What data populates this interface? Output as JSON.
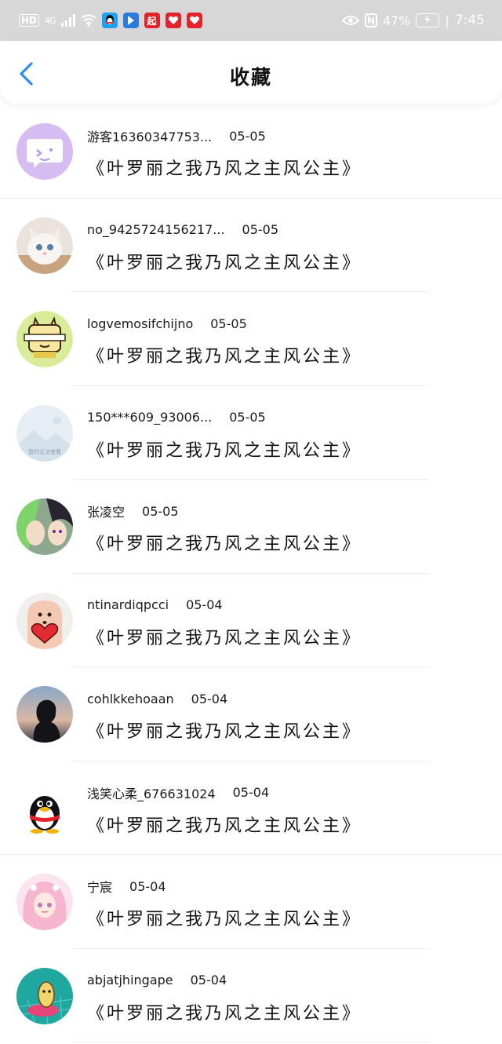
{
  "status_bar": {
    "hd": "HD",
    "signal": "4G",
    "app_qi": "起",
    "battery": "47%",
    "time": "7:45"
  },
  "header": {
    "title": "收藏",
    "back_icon": "chevron-left-icon",
    "accent": "#2f8cf0"
  },
  "items": [
    {
      "user": "游客16360347753...",
      "date": "05-05",
      "title": "《叶罗丽之我乃风之主风公主》"
    },
    {
      "user": "no_9425724156217...",
      "date": "05-05",
      "title": "《叶罗丽之我乃风之主风公主》"
    },
    {
      "user": "logvemosifchijno",
      "date": "05-05",
      "title": "《叶罗丽之我乃风之主风公主》"
    },
    {
      "user": "150***609_93006...",
      "date": "05-05",
      "title": "《叶罗丽之我乃风之主风公主》",
      "avatar_text": "暂时无法查看"
    },
    {
      "user": "张凌空",
      "date": "05-05",
      "title": "《叶罗丽之我乃风之主风公主》"
    },
    {
      "user": "ntinardiqpcci",
      "date": "05-04",
      "title": "《叶罗丽之我乃风之主风公主》"
    },
    {
      "user": "cohlkkehoaan",
      "date": "05-04",
      "title": "《叶罗丽之我乃风之主风公主》"
    },
    {
      "user": "浅笑心柔_676631024",
      "date": "05-04",
      "title": "《叶罗丽之我乃风之主风公主》"
    },
    {
      "user": "宁宸",
      "date": "05-04",
      "title": "《叶罗丽之我乃风之主风公主》"
    },
    {
      "user": "abjatjhingape",
      "date": "05-04",
      "title": "《叶罗丽之我乃风之主风公主》"
    }
  ]
}
